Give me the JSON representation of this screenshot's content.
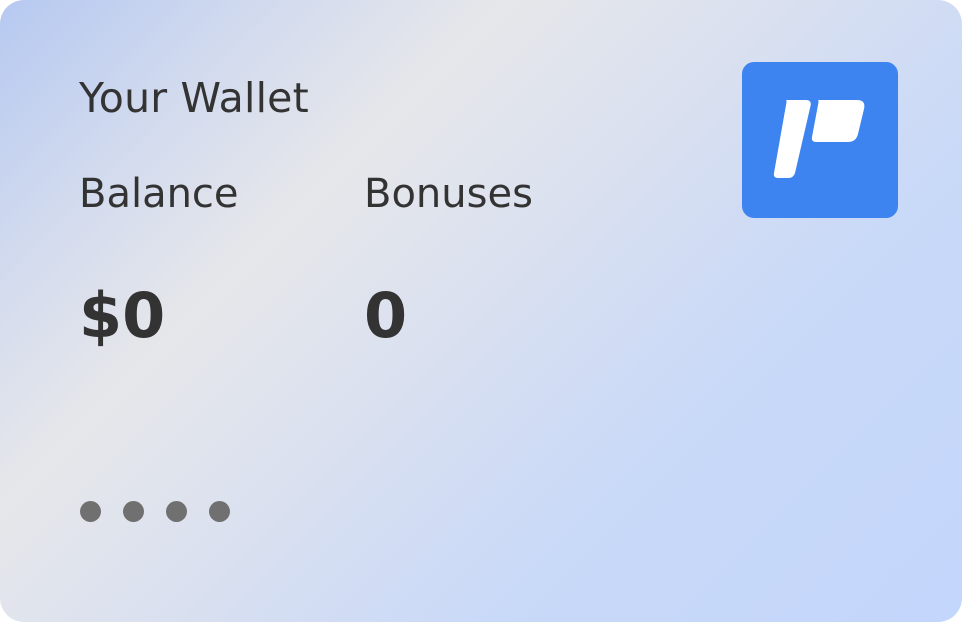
{
  "wallet": {
    "title": "Your Wallet",
    "balance_label": "Balance",
    "balance_value": "$0",
    "bonuses_label": "Bonuses",
    "bonuses_value": "0",
    "masked_number_dots": 4
  },
  "logo": {
    "icon": "brand-logo-icon",
    "color": "#3d84f1"
  }
}
